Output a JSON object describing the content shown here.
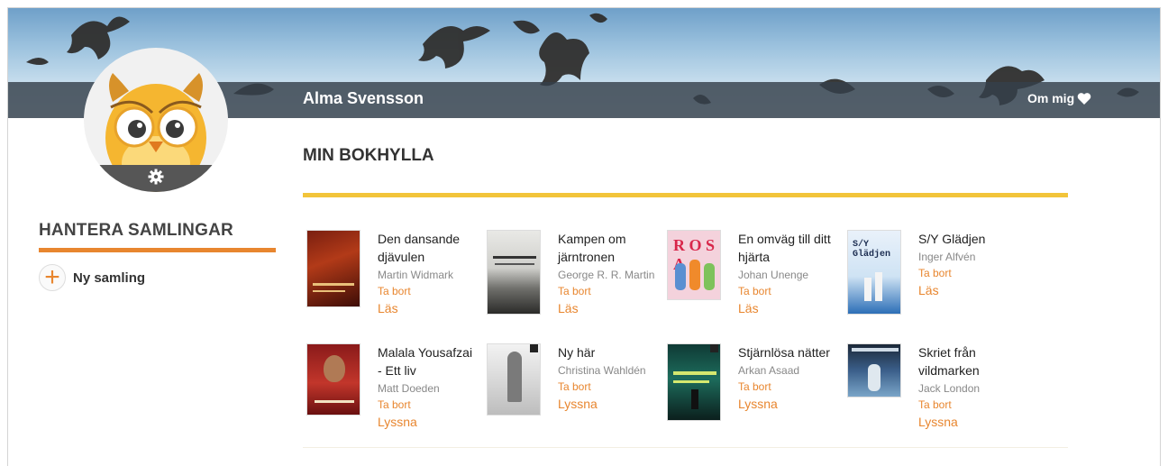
{
  "profile": {
    "name": "Alma Svensson",
    "about_label": "Om mig",
    "about_icon": "heart-icon"
  },
  "sidebar": {
    "title": "HANTERA SAMLINGAR",
    "new_collection_label": "Ny samling"
  },
  "main": {
    "title": "MIN BOKHYLLA"
  },
  "colors": {
    "accent_orange": "#e8862f",
    "shelf_yellow": "#f2c43a",
    "banner_bar": "#34404a"
  },
  "books": [
    {
      "title": "Den dansande djävulen",
      "author": "Martin Widmark",
      "remove": "Ta bort",
      "action": "Läs"
    },
    {
      "title": "Kampen om järntronen",
      "author": "George R. R. Martin",
      "remove": "Ta bort",
      "action": "Läs"
    },
    {
      "title": "En omväg till ditt hjärta",
      "author": "Johan Unenge",
      "remove": "Ta bort",
      "action": "Läs"
    },
    {
      "title": "S/Y Glädjen",
      "author": "Inger Alfvén",
      "remove": "Ta bort",
      "action": "Läs"
    },
    {
      "title": "Malala Yousafzai - Ett liv",
      "author": "Matt Doeden",
      "remove": "Ta bort",
      "action": "Lyssna"
    },
    {
      "title": "Ny här",
      "author": "Christina Wahldén",
      "remove": "Ta bort",
      "action": "Lyssna"
    },
    {
      "title": "Stjärnlösa nätter",
      "author": "Arkan Asaad",
      "remove": "Ta bort",
      "action": "Lyssna"
    },
    {
      "title": "Skriet från vildmarken",
      "author": "Jack London",
      "remove": "Ta bort",
      "action": "Lyssna"
    }
  ]
}
